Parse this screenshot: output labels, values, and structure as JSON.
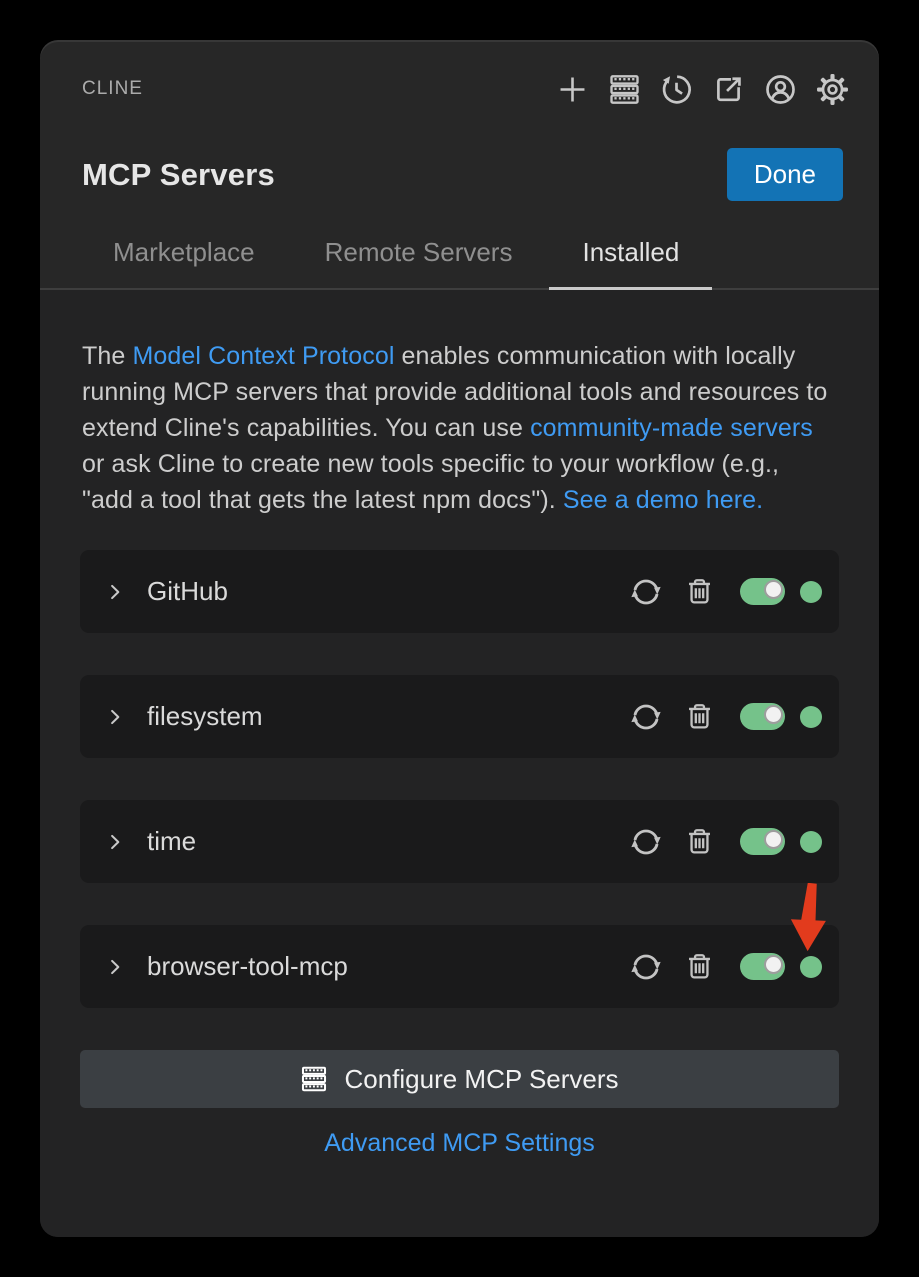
{
  "colors": {
    "accent_blue": "#1373b5",
    "link_blue": "#3f9bf3",
    "toggle_green": "#75c28a",
    "status_green": "#75c28a",
    "arrow_red": "#e23b1d"
  },
  "titlebar": {
    "app_label": "CLINE",
    "icons": [
      "plus",
      "mcp-servers",
      "history",
      "open-in-editor",
      "account",
      "settings-gear"
    ]
  },
  "header": {
    "title": "MCP Servers",
    "done_button": "Done"
  },
  "tabs": [
    {
      "label": "Marketplace",
      "active": false
    },
    {
      "label": "Remote Servers",
      "active": false
    },
    {
      "label": "Installed",
      "active": true
    }
  ],
  "description": {
    "segments": [
      {
        "text": "The "
      },
      {
        "text": "Model Context Protocol",
        "link": true
      },
      {
        "text": " enables communication with locally running MCP servers that provide additional tools and resources to extend Cline's capabilities. You can use "
      },
      {
        "text": "community-made servers",
        "link": true
      },
      {
        "text": " or ask Cline to create new tools specific to your workflow (e.g., \"add a tool that gets the latest npm docs\"). "
      },
      {
        "text": "See a demo here.",
        "link": true
      }
    ]
  },
  "servers": [
    {
      "name": "GitHub",
      "enabled": true,
      "status": "connected",
      "annotated": false
    },
    {
      "name": "filesystem",
      "enabled": true,
      "status": "connected",
      "annotated": false
    },
    {
      "name": "time",
      "enabled": true,
      "status": "connected",
      "annotated": false
    },
    {
      "name": "browser-tool-mcp",
      "enabled": true,
      "status": "connected",
      "annotated": true
    }
  ],
  "footer": {
    "configure_button": "Configure MCP Servers",
    "advanced_link": "Advanced MCP Settings"
  }
}
